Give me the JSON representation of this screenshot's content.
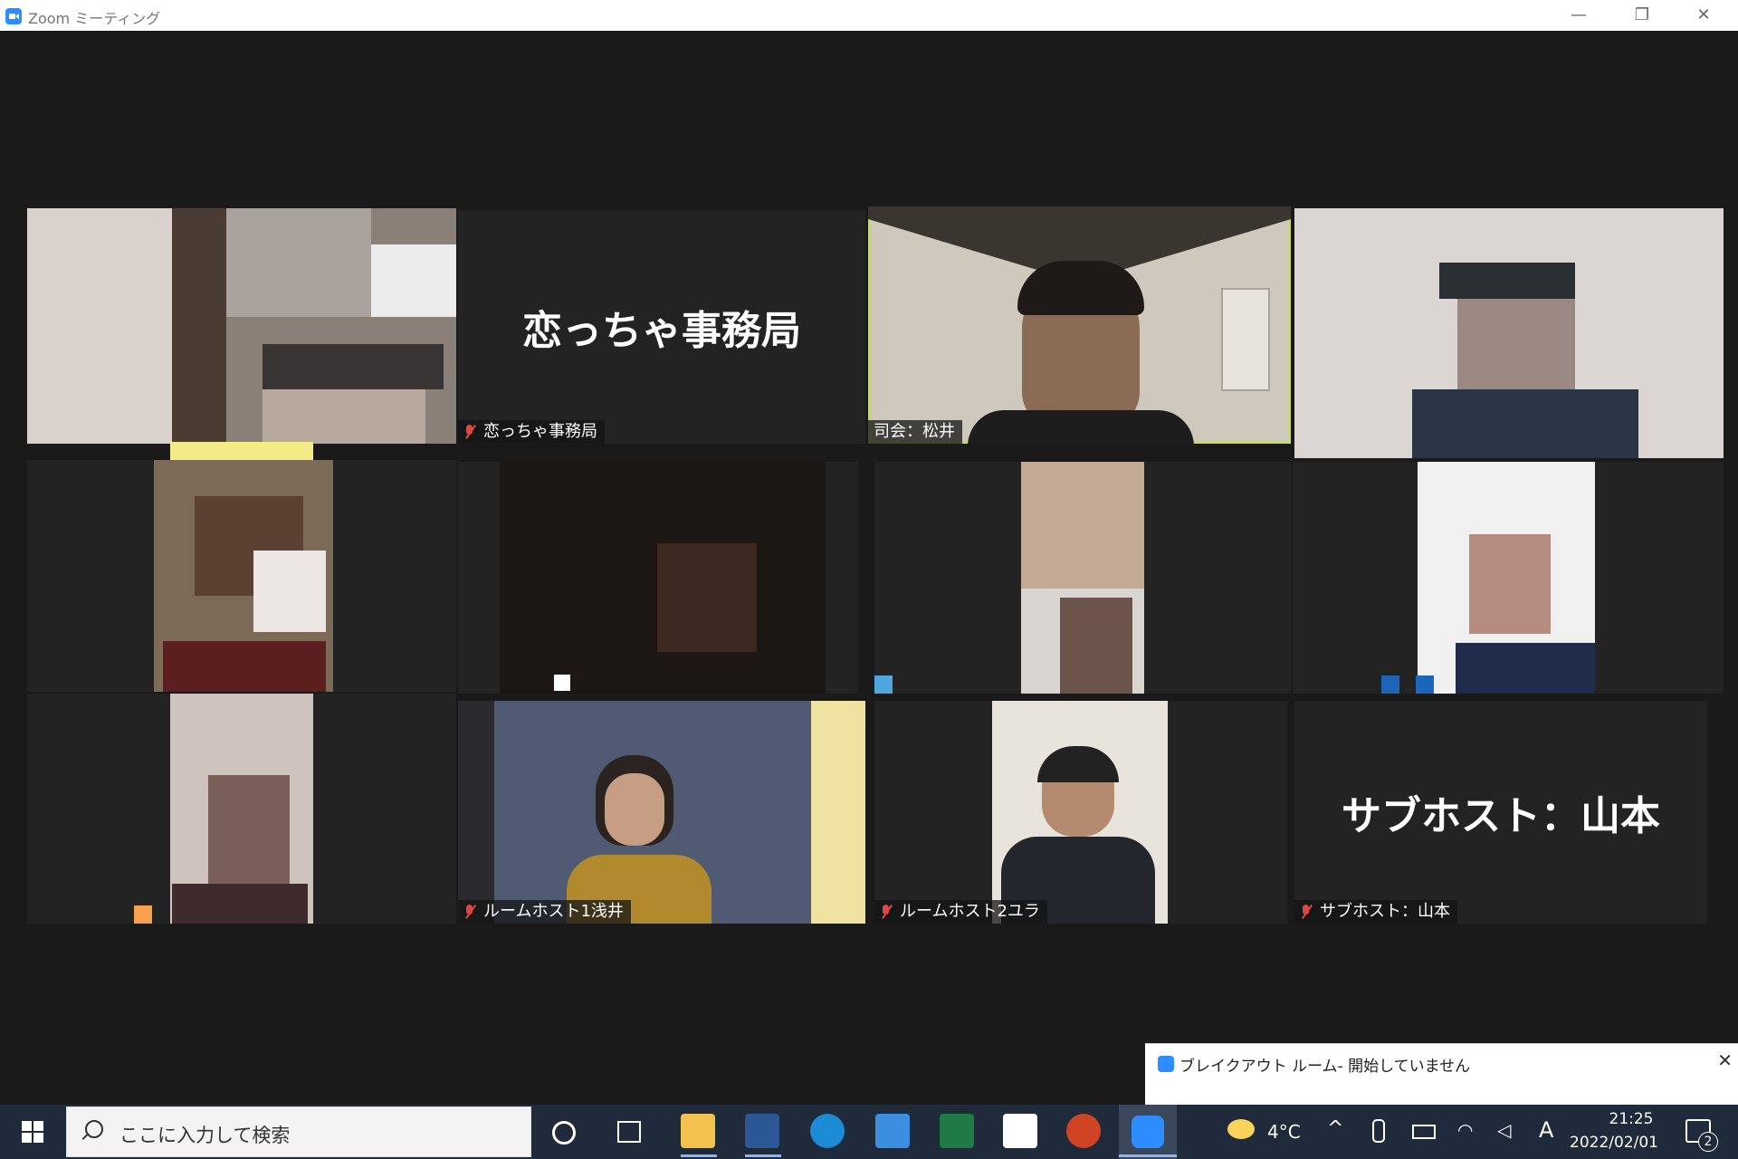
{
  "window": {
    "title": "Zoom ミーティング",
    "minimize": "—",
    "restore": "❐",
    "close": "✕"
  },
  "tiles": [
    {
      "name": "",
      "muted": false
    },
    {
      "name": "恋っちゃ事務局",
      "big_name": "恋っちゃ事務局",
      "muted": true
    },
    {
      "name": "司会：松井",
      "muted": false,
      "active_speaker": true
    },
    {
      "name": "",
      "muted": false
    },
    {
      "name": "",
      "muted": false
    },
    {
      "name": "",
      "muted": false
    },
    {
      "name": "",
      "muted": false
    },
    {
      "name": "",
      "muted": false
    },
    {
      "name": "",
      "muted": false
    },
    {
      "name": "ルームホスト1浅井",
      "muted": true
    },
    {
      "name": "ルームホスト2ユラ",
      "muted": true
    },
    {
      "name": "サブホスト：山本",
      "big_name": "サブホスト：山本",
      "muted": true
    }
  ],
  "breakout_popup": {
    "title": "ブレイクアウト ルーム- 開始していません",
    "close": "✕"
  },
  "taskbar": {
    "search_placeholder": "ここに入力して検索",
    "weather": "4°C",
    "ime": "A",
    "time": "21:25",
    "date": "2022/02/01",
    "notifications": "2",
    "apps": [
      "cortana-icon",
      "task-view-icon",
      "file-explorer-icon",
      "word-icon",
      "edge-icon",
      "mail-icon",
      "excel-icon",
      "store-icon",
      "powerpoint-icon",
      "zoom-icon"
    ]
  },
  "colors": {
    "active_speaker_border": "#c8e04a",
    "accent": "#2d8cff",
    "muted_icon": "#e04646"
  }
}
